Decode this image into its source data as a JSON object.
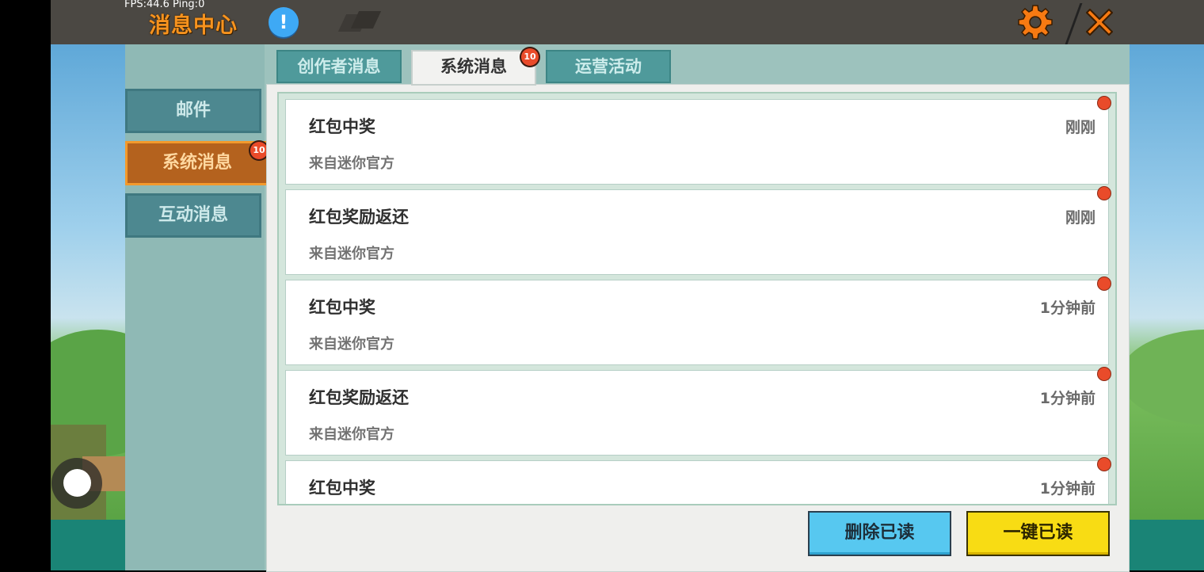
{
  "status": {
    "fps_text": "FPS:44.6  Ping:0"
  },
  "header": {
    "title": "消息中心",
    "info_icon": "!",
    "settings_icon": "gear-icon",
    "close_icon": "close-icon"
  },
  "sidebar": {
    "items": [
      {
        "label": "邮件",
        "active": false
      },
      {
        "label": "系统消息",
        "active": true,
        "badge": "10"
      },
      {
        "label": "互动消息",
        "active": false
      }
    ]
  },
  "tabs": [
    {
      "label": "创作者消息",
      "active": false
    },
    {
      "label": "系统消息",
      "active": true,
      "badge": "10"
    },
    {
      "label": "运营活动",
      "active": false
    }
  ],
  "messages": [
    {
      "title": "红包中奖",
      "time": "刚刚",
      "from": "来自迷你官方",
      "unread": true
    },
    {
      "title": "红包奖励返还",
      "time": "刚刚",
      "from": "来自迷你官方",
      "unread": true
    },
    {
      "title": "红包中奖",
      "time": "1分钟前",
      "from": "来自迷你官方",
      "unread": true
    },
    {
      "title": "红包奖励返还",
      "time": "1分钟前",
      "from": "来自迷你官方",
      "unread": true
    },
    {
      "title": "红包中奖",
      "time": "1分钟前",
      "from": "",
      "unread": true
    }
  ],
  "actions": {
    "delete_read": "删除已读",
    "mark_all_read": "一键已读"
  },
  "colors": {
    "accent_orange": "#f7931e",
    "unread_dot": "#e94b2a",
    "delete_button": "#57c8f0",
    "read_all_button": "#f8dc14"
  }
}
